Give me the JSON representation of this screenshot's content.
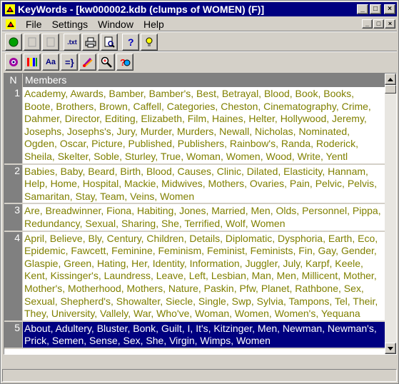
{
  "window": {
    "title": "KeyWords - [kw000002.kdb (clumps of WOMEN) (F)]"
  },
  "caption_buttons": {
    "minimize": "_",
    "maximize": "□",
    "close": "×"
  },
  "menu": {
    "items": [
      "File",
      "Settings",
      "Window",
      "Help"
    ]
  },
  "toolbar1": {
    "txt_label": ".txt"
  },
  "toolbar2": {
    "aa_label": "Aa"
  },
  "grid": {
    "headers": {
      "n": "N",
      "members": "Members"
    },
    "rows": [
      {
        "n": "1",
        "members": "Academy, Awards, Bamber, Bamber's, Best, Betrayal, Blood, Book, Books, Boote, Brothers, Brown, Caffell, Categories, Cheston, Cinematography, Crime, Dahmer, Director, Editing, Elizabeth, Film, Haines, Helter, Hollywood, Jeremy, Josephs, Josephs's, Jury, Murder, Murders, Newall, Nicholas, Nominated, Ogden, Oscar, Picture, Published, Publishers, Rainbow's, Randa, Roderick, Sheila, Skelter, Soble, Sturley, True, Woman, Women, Wood, Write, Yentl"
      },
      {
        "n": "2",
        "members": "Babies, Baby, Beard, Birth, Blood, Causes, Clinic, Dilated, Elasticity, Hannam, Help, Home, Hospital, Mackie, Midwives, Mothers, Ovaries, Pain, Pelvic, Pelvis, Samaritan, Stay, Team, Veins, Women"
      },
      {
        "n": "3",
        "members": "Are, Breadwinner, Fiona, Habiting, Jones, Married, Men, Olds, Personnel, Pippa, Redundancy, Sexual, Sharing, She, Terrified, Wolf, Women"
      },
      {
        "n": "4",
        "members": "April, Believe, Bly, Century, Children, Details, Diplomatic, Dysphoria, Earth, Eco, Epidemic, Fawcett, Feminine, Feminism, Feminist, Feminists, Fin, Gay, Gender, Glaspie, Green, Hating, Her, Identity, Information, Juggler, July, Karpf, Keele, Kent, Kissinger's, Laundress, Leave, Left, Lesbian, Man, Men, Millicent, Mother, Mother's, Motherhood, Mothers, Nature, Paskin, Pfw, Planet, Rathbone, Sex, Sexual, Shepherd's, Showalter, Siecle, Single, Swp, Sylvia, Tampons, Tel, Their, They, University, Vallely, War, Who've, Woman, Women, Women's, Yequana"
      },
      {
        "n": "5",
        "members": "About, Adultery, Bluster, Bonk, Guilt, I, It's, Kitzinger, Men, Newman, Newman's, Prick, Semen, Sense, Sex, She, Virgin, Wimps, Women"
      }
    ]
  },
  "colors": {
    "titlebar": "#000080",
    "member_text": "#808000",
    "selected_row": "#000080",
    "face": "#d4d0c8"
  }
}
